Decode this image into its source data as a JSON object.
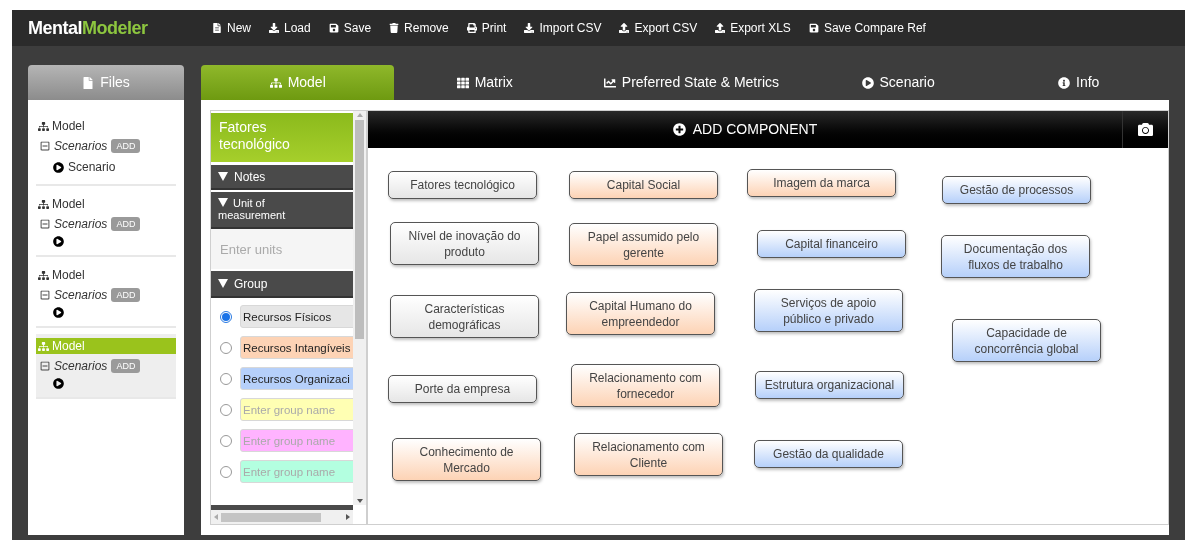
{
  "logo": {
    "first": "Mental",
    "second": "Modeler"
  },
  "toolbar": [
    {
      "label": "New"
    },
    {
      "label": "Load"
    },
    {
      "label": "Save"
    },
    {
      "label": "Remove"
    },
    {
      "label": "Print"
    },
    {
      "label": "Import CSV"
    },
    {
      "label": "Export CSV"
    },
    {
      "label": "Export XLS"
    },
    {
      "label": "Save Compare Ref"
    }
  ],
  "sidebar": {
    "tab": "Files",
    "files": [
      {
        "model": "Model",
        "selected": false,
        "scenarios_label": "Scenarios",
        "add": "ADD",
        "scenarios": [
          {
            "kind": "play",
            "label": "Scenario"
          }
        ]
      },
      {
        "model": "Model",
        "selected": false,
        "scenarios_label": "Scenarios",
        "add": "ADD",
        "scenarios": [
          {
            "kind": "play"
          }
        ]
      },
      {
        "model": "Model",
        "selected": false,
        "scenarios_label": "Scenarios",
        "add": "ADD",
        "scenarios": [
          {
            "kind": "play"
          }
        ]
      },
      {
        "model": "Model",
        "selected": true,
        "scenarios_label": "Scenarios",
        "add": "ADD",
        "scenarios": [
          {
            "kind": "play"
          }
        ]
      }
    ]
  },
  "tabs": [
    {
      "label": "Model",
      "selected": true
    },
    {
      "label": "Matrix",
      "selected": false
    },
    {
      "label": "Preferred State & Metrics",
      "selected": false
    },
    {
      "label": "Scenario",
      "selected": false
    },
    {
      "label": "Info",
      "selected": false
    }
  ],
  "properties": {
    "title": "Fatores tecnológico",
    "notes": "Notes",
    "unit_header": "Unit of measurement",
    "unit_placeholder": "Enter units",
    "group_header": "Group",
    "groups": [
      {
        "value": "Recursos Físicos",
        "color": "#e6e6e6",
        "selected": true
      },
      {
        "value": "Recursos Intangíveis",
        "color": "#fdd3b5",
        "selected": false
      },
      {
        "value": "Recursos Organizaci",
        "color": "#b6d0fa",
        "selected": false
      },
      {
        "placeholder": "Enter group name",
        "color": "#ffffb3",
        "selected": false
      },
      {
        "placeholder": "Enter group name",
        "color": "#ffb3ff",
        "selected": false
      },
      {
        "placeholder": "Enter group name",
        "color": "#b3ffe0",
        "selected": false
      }
    ]
  },
  "canvas": {
    "add_component": "ADD COMPONENT",
    "nodes": [
      {
        "label": "Fatores tecnológico",
        "color": "#e6e6e6"
      },
      {
        "label": "Nível de inovação do produto",
        "color": "#e6e6e6"
      },
      {
        "label": "Características demográficas",
        "color": "#e6e6e6"
      },
      {
        "label": "Porte da empresa",
        "color": "#e6e6e6"
      },
      {
        "label": "Conhecimento de Mercado",
        "color": "#fdd3b5"
      },
      {
        "label": "Capital Social",
        "color": "#fdd3b5"
      },
      {
        "label": "Papel assumido pelo gerente",
        "color": "#fdd3b5"
      },
      {
        "label": "Capital Humano do empreendedor",
        "color": "#fdd3b5"
      },
      {
        "label": "Relacionamento com fornecedor",
        "color": "#fdd3b5"
      },
      {
        "label": "Relacionamento com Cliente",
        "color": "#fdd3b5"
      },
      {
        "label": "Imagem da marca",
        "color": "#fdd3b5"
      },
      {
        "label": "Capital financeiro",
        "color": "#b6d0fa"
      },
      {
        "label": "Serviços de apoio público e privado",
        "color": "#b6d0fa"
      },
      {
        "label": "Estrutura organizacional",
        "color": "#b6d0fa"
      },
      {
        "label": "Gestão da qualidade",
        "color": "#b6d0fa"
      },
      {
        "label": "Gestão de processos",
        "color": "#b6d0fa"
      },
      {
        "label": "Documentação dos fluxos de trabalho",
        "color": "#b6d0fa"
      },
      {
        "label": "Capacidade de concorrência global",
        "color": "#b6d0fa"
      }
    ]
  }
}
